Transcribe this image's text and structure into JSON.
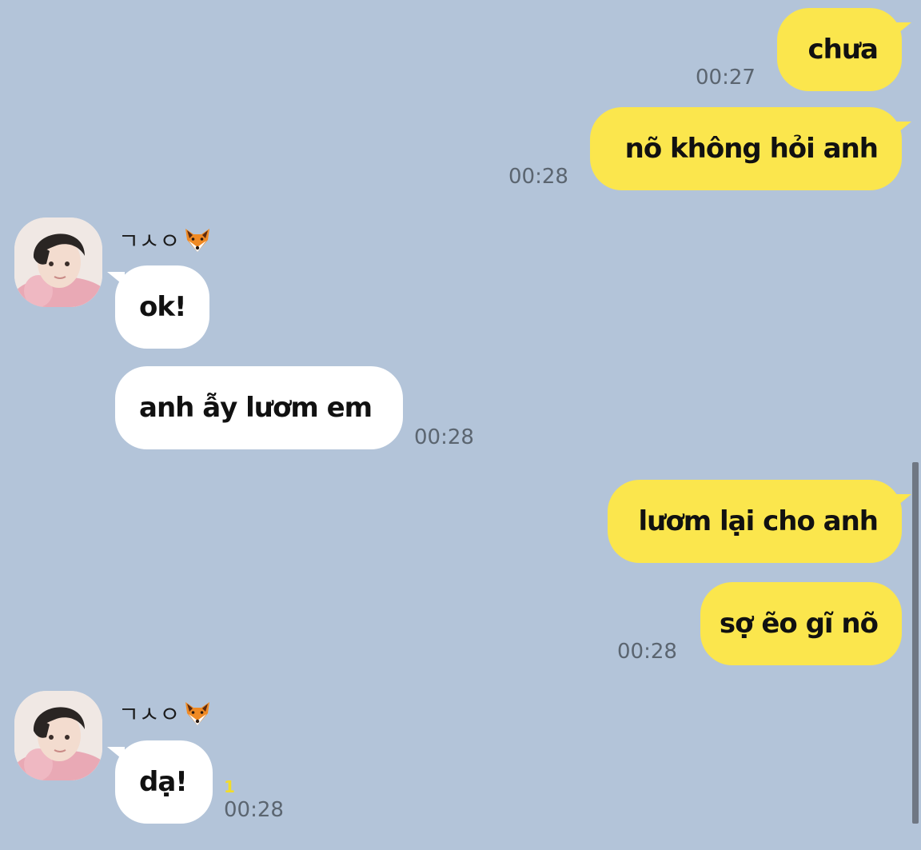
{
  "messages": [
    {
      "text": "chưa",
      "time": "00:27"
    },
    {
      "text": "nõ không hỏi anh",
      "time": "00:28"
    },
    {
      "sender": "ㄱㅅㅇ",
      "text": "ok!"
    },
    {
      "text": "anh ẫy lươm em",
      "time": "00:28"
    },
    {
      "text": "lươm lại cho anh"
    },
    {
      "text": "sợ ẽo gĩ nõ",
      "time": "00:28"
    },
    {
      "sender": "ㄱㅅㅇ",
      "text": "dạ!",
      "unread": "1",
      "time": "00:28"
    }
  ],
  "colors": {
    "background": "#b3c4d9",
    "outgoing_bubble": "#fbe64d",
    "incoming_bubble": "#ffffff",
    "timestamp": "#5b6570"
  },
  "icons": {
    "sender_emoji": "fox-face-icon"
  }
}
